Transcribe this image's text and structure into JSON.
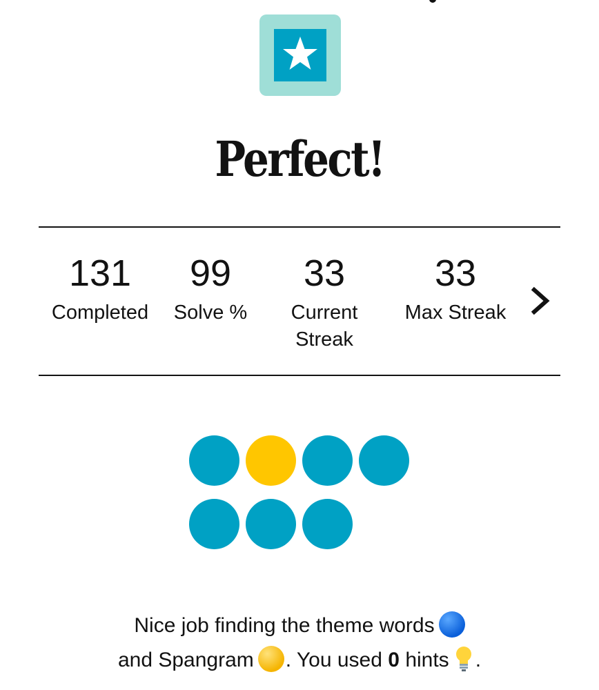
{
  "result": {
    "headline": "Perfect!",
    "badge_icon": "star-icon"
  },
  "stats": [
    {
      "value": "131",
      "label": "Completed"
    },
    {
      "value": "99",
      "label": "Solve %"
    },
    {
      "value": "33",
      "label": "Current Streak"
    },
    {
      "value": "33",
      "label": "Max Streak"
    }
  ],
  "stats_nav_icon": "chevron-right-icon",
  "progress_dots": {
    "row1": [
      "theme",
      "spangram",
      "theme",
      "theme"
    ],
    "row2": [
      "theme",
      "theme",
      "theme"
    ]
  },
  "summary": {
    "line1_text": "Nice job finding the theme words",
    "line2_prefix": "and Spangram",
    "line2_middle": ". You used",
    "hints_count": "0",
    "line2_suffix": "hints",
    "end_punct": "."
  },
  "colors": {
    "theme": "#00a1c4",
    "spangram": "#ffc600",
    "badge_outer": "#9fded7",
    "badge_inner": "#00a1c4",
    "text": "#121212"
  }
}
